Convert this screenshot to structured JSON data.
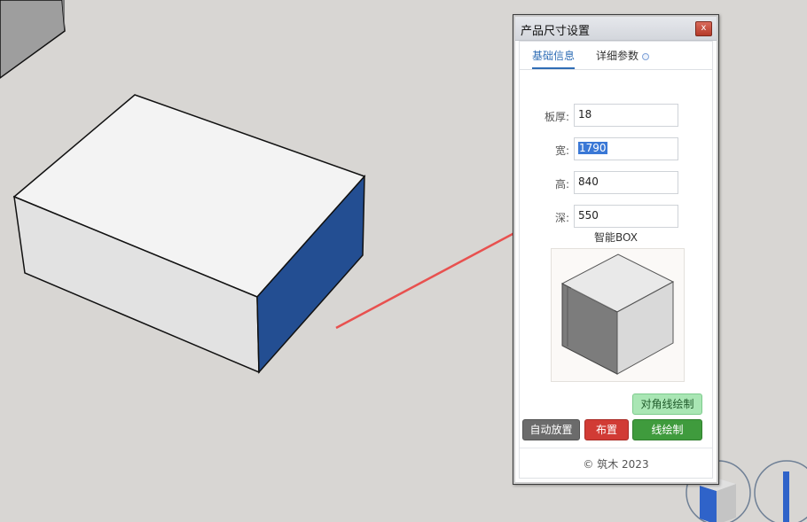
{
  "dialog": {
    "title": "产品尺寸设置",
    "close_glyph": "x",
    "tabs": [
      {
        "label": "基础信息",
        "active": true
      },
      {
        "label": "详细参数",
        "active": false
      }
    ],
    "fields": [
      {
        "label": "板厚:",
        "value": "18"
      },
      {
        "label": "宽:",
        "value": "1790",
        "selected": true
      },
      {
        "label": "高:",
        "value": "840"
      },
      {
        "label": "深:",
        "value": "550"
      }
    ],
    "preview_title": "智能BOX",
    "buttons": {
      "diagonal": "对角线绘制",
      "auto_place": "自动放置",
      "layout": "布置",
      "line_draw": "线绘制"
    },
    "footer": "© 筑木 2023"
  },
  "colors": {
    "accent_blue": "#2f6db5",
    "box_side": "#234e92",
    "arrow": "#e8514f",
    "btn_gray": "#6b6b6b",
    "btn_red": "#d13b35",
    "btn_green": "#3f9b3d",
    "btn_light_green": "#a9e6b4"
  }
}
